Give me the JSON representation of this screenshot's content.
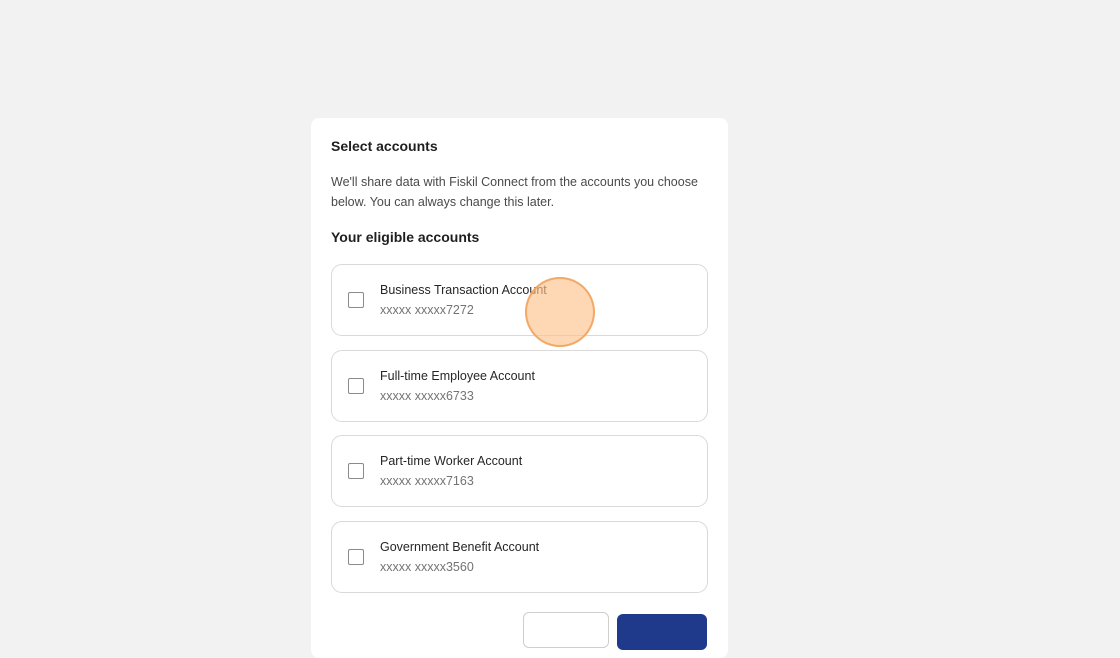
{
  "dialog": {
    "title": "Select accounts",
    "description": "We'll share data with Fiskil Connect from the accounts you choose below. You can always change this later.",
    "section_heading": "Your eligible accounts"
  },
  "accounts": [
    {
      "name": "Business Transaction Account",
      "number": "xxxxx xxxxx7272",
      "checked": false
    },
    {
      "name": "Full-time Employee Account",
      "number": "xxxxx xxxxx6733",
      "checked": false
    },
    {
      "name": "Part-time Worker Account",
      "number": "xxxxx xxxxx7163",
      "checked": false
    },
    {
      "name": "Government Benefit Account",
      "number": "xxxxx xxxxx3560",
      "checked": false
    }
  ],
  "buttons": {
    "secondary_label": "",
    "primary_label": ""
  },
  "colors": {
    "background": "#f2f2f2",
    "card": "#ffffff",
    "primary_button": "#1f3a8a",
    "click_indicator": "#fdc18c"
  }
}
